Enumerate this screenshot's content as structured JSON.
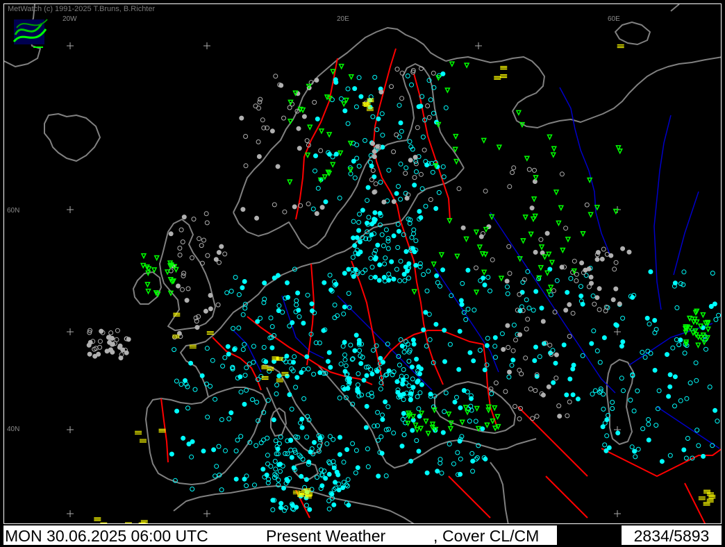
{
  "window": {
    "copyright": "MetWatch  (c) 1991-2025 T.Bruns, B.Richter"
  },
  "grid_labels": {
    "lon_20w": "20W",
    "lon_20e": "20E",
    "lon_60e": "60E",
    "lat_60n": "60N",
    "lat_40n": "40N",
    "lat_50n": "50N"
  },
  "status": {
    "datetime": "MON 30.06.2025 06:00 UTC",
    "parameter": "Present Weather",
    "separator": ",",
    "cover": "Cover CL/CM",
    "count": "2834/5893"
  },
  "colors": {
    "background": "#000000",
    "coastline": "#808080",
    "borders": "#ff0000",
    "rivers": "#0000c8",
    "station_clear": "#00ffff",
    "station_cloudy": "#b0b0b0",
    "showers": "#00ff00",
    "fog_haze": "#ffff00",
    "status_bg": "#ffffff",
    "status_text": "#000000"
  },
  "icons": {
    "logo": "metwatch-logo",
    "grid_cross": "plus-marker",
    "station": "circle-station-marker",
    "shower": "shower-symbol",
    "fog": "fog-symbol"
  }
}
